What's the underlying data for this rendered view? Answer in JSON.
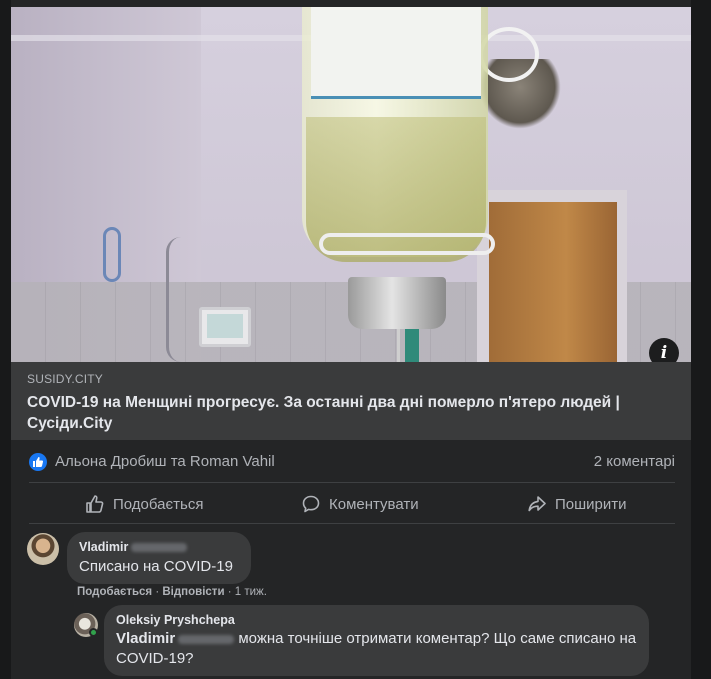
{
  "post": {
    "link_domain": "SUSIDY.CITY",
    "link_title": "COVID-19 на Менщині прогресує. За останні два дні померло п'ятеро людей | Сусіди.City",
    "reactors": "Альона Дробиш та Roman Vahil",
    "comment_count": "2 коментарі",
    "info_glyph": "i"
  },
  "actions": {
    "like": "Подобається",
    "comment": "Коментувати",
    "share": "Поширити"
  },
  "comments": [
    {
      "author": "Vladimir",
      "text": "Списано на COVID-19",
      "like_label": "Подобається",
      "reply_label": "Відповісти",
      "separator": "·",
      "time": "1 тиж."
    }
  ],
  "reply": {
    "author": "Oleksiy Pryshchepa",
    "mention": "Vladimir",
    "text": "можна точніше отримати коментар? Що саме списано на COVID-19?"
  },
  "colors": {
    "background": "#18191a",
    "card": "#242526",
    "bubble": "#3a3b3c",
    "accent": "#1877f2",
    "online": "#31a24c"
  }
}
